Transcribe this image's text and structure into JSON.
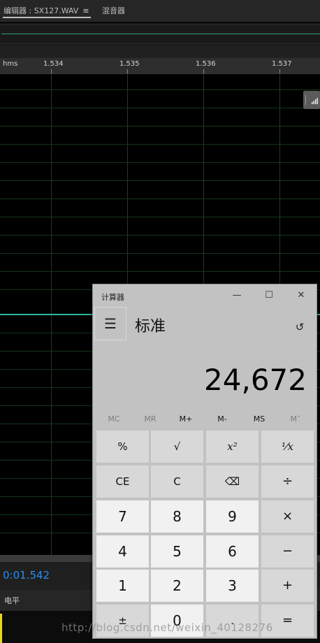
{
  "editor": {
    "tabs": [
      "编辑器 : SX127.WAV",
      "混音器"
    ],
    "tab_menu_glyph": "≡",
    "ruler": {
      "unit": "hms",
      "ticks": [
        "1.534",
        "1.535",
        "1.536",
        "1.537"
      ]
    },
    "current_time": "0:01.542",
    "level_label": "电平",
    "waveform_color": "#32b79e",
    "grid_color": "#13421d",
    "time_color": "#2d8ceb"
  },
  "calculator": {
    "title": "计算器",
    "window_controls": [
      "—",
      "☐",
      "✕"
    ],
    "menu_icon": "hamburger-icon",
    "menu_glyph": "☰",
    "mode": "标准",
    "history_icon": "history-icon",
    "history_glyph": "↺",
    "display_value": "24,672",
    "memory": [
      {
        "label": "MC",
        "enabled": false
      },
      {
        "label": "MR",
        "enabled": false
      },
      {
        "label": "M+",
        "enabled": true
      },
      {
        "label": "M-",
        "enabled": true
      },
      {
        "label": "MS",
        "enabled": true
      },
      {
        "label": "M˅",
        "enabled": false
      }
    ],
    "keys": [
      [
        "%",
        "√",
        "x²",
        "¹⁄x"
      ],
      [
        "CE",
        "C",
        "⌫",
        "÷"
      ],
      [
        "7",
        "8",
        "9",
        "×"
      ],
      [
        "4",
        "5",
        "6",
        "−"
      ],
      [
        "1",
        "2",
        "3",
        "+"
      ],
      [
        "±",
        "0",
        ".",
        "="
      ]
    ]
  },
  "watermark": "http://blog.csdn.net/weixin_40128276"
}
